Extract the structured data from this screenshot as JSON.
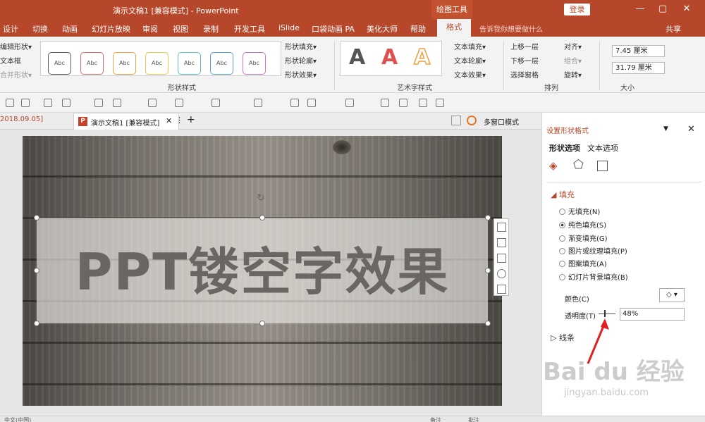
{
  "title_bar": {
    "doc_title": "演示文稿1 [兼容模式]  -  PowerPoint",
    "context_tool": "绘图工具",
    "login": "登录",
    "minimize": "—",
    "restore": "▢",
    "close": "✕"
  },
  "menu": {
    "tabs": [
      "设计",
      "切换",
      "动画",
      "幻灯片放映",
      "审阅",
      "视图",
      "录制",
      "开发工具",
      "iSlide",
      "口袋动画 PA",
      "美化大师",
      "帮助"
    ],
    "active_tab": "格式",
    "tell_me": "告诉我你想要做什么",
    "share": "共享"
  },
  "ribbon": {
    "insert_shapes": {
      "edit_shape": "编辑形状▾",
      "text_box": "文本框",
      "merge_shapes": "合并形状▾"
    },
    "shape_styles": {
      "sample": "Abc",
      "label": "形状样式",
      "fill": "形状填充▾",
      "outline": "形状轮廓▾",
      "effect": "形状效果▾"
    },
    "style_colors": [
      "#5a5a5a",
      "#e46b6b",
      "#f0a040",
      "#e8c84c",
      "#5bc0c0",
      "#5aa0e0",
      "#c77ac7"
    ],
    "art_styles": {
      "letter": "A",
      "label": "艺术字样式",
      "fill": "文本填充▾",
      "outline": "文本轮廓▾",
      "effect": "文本效果▾",
      "colors": [
        "#555555",
        "#e0504c",
        "#f0a040"
      ]
    },
    "arrange": {
      "label": "排列",
      "bring_forward": "上移一层",
      "send_backward": "下移一层",
      "selection_pane": "选择窗格",
      "align": "对齐▾",
      "group": "组合▾",
      "rotate": "旋转▾"
    },
    "size": {
      "label": "大小",
      "height": "7.45 厘米",
      "width": "31.79 厘米"
    }
  },
  "doc_tabs": {
    "tab1": "2018.09.05]",
    "tab2_icon": "P",
    "tab2": "演示文稿1 [兼容模式]",
    "close": "✕",
    "more": "⋮",
    "add": "+",
    "multi_window": "多窗口模式"
  },
  "slide": {
    "title": "PPT镂空字效果",
    "rotate_glyph": "↻"
  },
  "format_pane": {
    "title": "设置形状格式",
    "dropdown_arrow": "▼",
    "close": "✕",
    "tab_shape": "形状选项",
    "tab_text": "文本选项",
    "fill_section": "◢ 填充",
    "fill_options": [
      "无填充(N)",
      "纯色填充(S)",
      "渐变填充(G)",
      "图片或纹理填充(P)",
      "图案填充(A)",
      "幻灯片背景填充(B)"
    ],
    "selected_fill": 1,
    "color_label": "颜色(C)",
    "color_btn": "◇ ▾",
    "transparency_label": "透明度(T)",
    "transparency_value": "48%",
    "line_section": "▷  线条"
  },
  "watermark": {
    "brand": "Bai du 经验",
    "url": "jingyan.baidu.com"
  },
  "status": {
    "left": "中文(中国)",
    "notes": "备注",
    "comments": "批注"
  }
}
